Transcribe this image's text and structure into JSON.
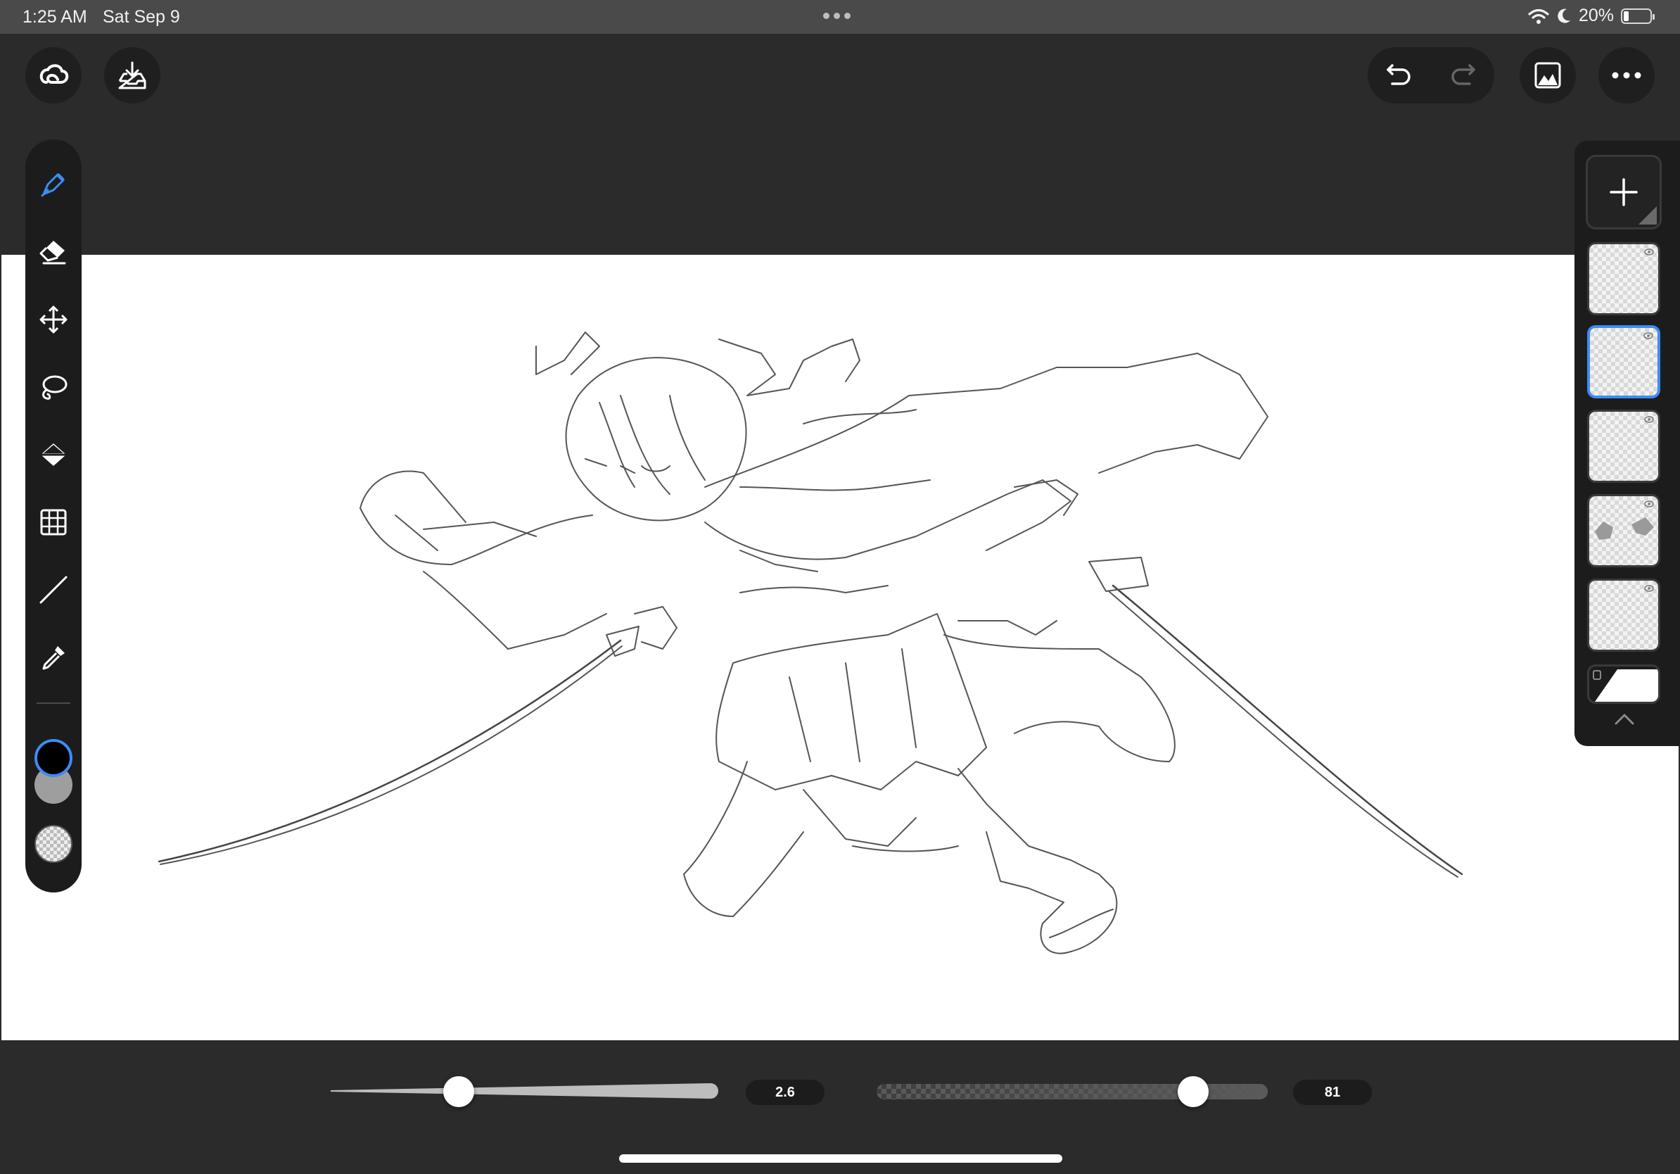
{
  "status": {
    "time": "1:25 AM",
    "date": "Sat Sep 9",
    "battery_text": "20%",
    "battery_level": 0.2
  },
  "header": {
    "icons": [
      "creative-cloud-icon",
      "import-icon",
      "undo-icon",
      "redo-icon",
      "gallery-icon",
      "more-icon"
    ]
  },
  "tools": {
    "items": [
      "pen-icon",
      "eraser-icon",
      "move-icon",
      "lasso-icon",
      "fill-icon",
      "grid-icon",
      "line-icon",
      "eyedropper-icon"
    ],
    "active": "pen-icon",
    "primary_color": "#000000",
    "secondary_color": "#9e9e9e",
    "accent": "#3d8cf5"
  },
  "layers": {
    "count": 5,
    "selected_index": 1
  },
  "brush": {
    "size_value": "2.6",
    "size_fraction": 0.33,
    "opacity_value": "81",
    "opacity_fraction": 0.81
  }
}
